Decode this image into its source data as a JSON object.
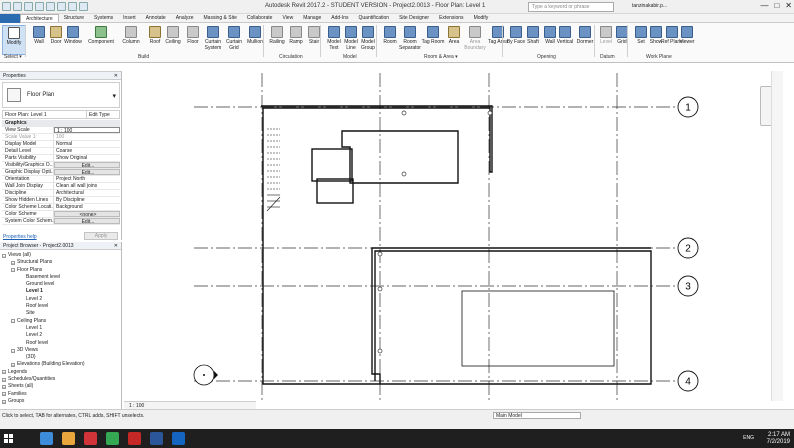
{
  "window": {
    "title": "Autodesk Revit 2017.2 - STUDENT VERSION -      Project2.0013 - Floor Plan: Level 1",
    "search_placeholder": "Type a keyword or phrase",
    "user": "tanzinakabir.p...",
    "controls": [
      "—",
      "□",
      "✕"
    ]
  },
  "ribbon_tabs": [
    "Architecture",
    "Structure",
    "Systems",
    "Insert",
    "Annotate",
    "Analyze",
    "Massing & Site",
    "Collaborate",
    "View",
    "Manage",
    "Add-Ins",
    "Quantification",
    "Site Designer",
    "Extensions",
    "Modify"
  ],
  "ribbon_buttons": [
    {
      "label": "Modify",
      "icon": "cursor-icon"
    },
    {
      "label": "Wall",
      "icon": "wall-icon"
    },
    {
      "label": "Door",
      "icon": "door-icon"
    },
    {
      "label": "Window",
      "icon": "window-icon"
    },
    {
      "label": "Component",
      "icon": "component-icon"
    },
    {
      "label": "Column",
      "icon": "column-icon"
    },
    {
      "label": "Roof",
      "icon": "roof-icon"
    },
    {
      "label": "Ceiling",
      "icon": "ceiling-icon"
    },
    {
      "label": "Floor",
      "icon": "floor-icon"
    },
    {
      "label": "Curtain System",
      "icon": "curtain-system-icon"
    },
    {
      "label": "Curtain Grid",
      "icon": "curtain-grid-icon"
    },
    {
      "label": "Mullion",
      "icon": "mullion-icon"
    },
    {
      "label": "Railing",
      "icon": "railing-icon"
    },
    {
      "label": "Ramp",
      "icon": "ramp-icon"
    },
    {
      "label": "Stair",
      "icon": "stair-icon"
    },
    {
      "label": "Model Text",
      "icon": "model-text-icon"
    },
    {
      "label": "Model Line",
      "icon": "model-line-icon"
    },
    {
      "label": "Model Group",
      "icon": "model-group-icon"
    },
    {
      "label": "Room",
      "icon": "room-icon"
    },
    {
      "label": "Room Separator",
      "icon": "room-separator-icon"
    },
    {
      "label": "Tag Room",
      "icon": "tag-room-icon"
    },
    {
      "label": "Area",
      "icon": "area-icon"
    },
    {
      "label": "Area Boundary",
      "icon": "area-boundary-icon"
    },
    {
      "label": "Tag Area",
      "icon": "tag-area-icon"
    },
    {
      "label": "By Face",
      "icon": "by-face-icon"
    },
    {
      "label": "Shaft",
      "icon": "shaft-icon"
    },
    {
      "label": "Wall",
      "icon": "wall-opening-icon"
    },
    {
      "label": "Vertical",
      "icon": "vertical-icon"
    },
    {
      "label": "Dormer",
      "icon": "dormer-icon"
    },
    {
      "label": "Level",
      "icon": "level-icon"
    },
    {
      "label": "Grid",
      "icon": "grid-icon"
    },
    {
      "label": "Set",
      "icon": "set-icon"
    },
    {
      "label": "Show",
      "icon": "show-icon"
    },
    {
      "label": "Ref Plane",
      "icon": "ref-plane-icon"
    },
    {
      "label": "Viewer",
      "icon": "viewer-icon"
    }
  ],
  "panel_labels": [
    "Select ▾",
    "Build",
    "Circulation",
    "Model",
    "Room & Area ▾",
    "Opening",
    "Datum",
    "Work Plane"
  ],
  "properties": {
    "title": "Properties",
    "type_name": "Floor Plan",
    "instance": "Floor Plan: Level 1",
    "edit_type": "Edit Type",
    "rows": [
      {
        "k": "Graphics",
        "v": "",
        "group": true
      },
      {
        "k": "View Scale",
        "v": "1 : 100",
        "box": true
      },
      {
        "k": "Scale Value    1:",
        "v": "100",
        "dim": true
      },
      {
        "k": "Display Model",
        "v": "Normal"
      },
      {
        "k": "Detail Level",
        "v": "Coarse"
      },
      {
        "k": "Parts Visibility",
        "v": "Show Original"
      },
      {
        "k": "Visibility/Graphics O...",
        "v": "Edit...",
        "btn": true
      },
      {
        "k": "Graphic Display Opti...",
        "v": "Edit...",
        "btn": true
      },
      {
        "k": "Orientation",
        "v": "Project North"
      },
      {
        "k": "Wall Join Display",
        "v": "Clean all wall joins"
      },
      {
        "k": "Discipline",
        "v": "Architectural"
      },
      {
        "k": "Show Hidden Lines",
        "v": "By Discipline"
      },
      {
        "k": "Color Scheme Locati...",
        "v": "Background"
      },
      {
        "k": "Color Scheme",
        "v": "<none>",
        "btn": true
      },
      {
        "k": "System Color Schem...",
        "v": "Edit...",
        "btn": true
      }
    ],
    "help": "Properties help",
    "apply": "Apply"
  },
  "browser": {
    "title": "Project Browser - Project2.0013",
    "items": [
      {
        "label": "Views (all)",
        "level": 0,
        "toggle": "−"
      },
      {
        "label": "Structural Plans",
        "level": 1,
        "toggle": "+"
      },
      {
        "label": "Floor Plans",
        "level": 1,
        "toggle": "−"
      },
      {
        "label": "Basement level",
        "level": 2
      },
      {
        "label": "Ground level",
        "level": 2
      },
      {
        "label": "Level 1",
        "level": 2,
        "bold": true
      },
      {
        "label": "Level 2",
        "level": 2
      },
      {
        "label": "Roof level",
        "level": 2
      },
      {
        "label": "Site",
        "level": 2
      },
      {
        "label": "Ceiling Plans",
        "level": 1,
        "toggle": "−"
      },
      {
        "label": "Level 1",
        "level": 2
      },
      {
        "label": "Level 2",
        "level": 2
      },
      {
        "label": "Roof level",
        "level": 2
      },
      {
        "label": "3D Views",
        "level": 1,
        "toggle": "−"
      },
      {
        "label": "{3D}",
        "level": 2
      },
      {
        "label": "Elevations (Building Elevation)",
        "level": 1,
        "toggle": "+"
      },
      {
        "label": "Legends",
        "level": 0,
        "toggle": "+"
      },
      {
        "label": "Schedules/Quantities",
        "level": 0,
        "toggle": "+"
      },
      {
        "label": "Sheets (all)",
        "level": 0,
        "toggle": "+"
      },
      {
        "label": "Families",
        "level": 0,
        "toggle": "+"
      },
      {
        "label": "Groups",
        "level": 0,
        "toggle": "+"
      }
    ]
  },
  "view_bar": {
    "scale": "1 : 100"
  },
  "grid_labels": [
    "1",
    "2",
    "3",
    "4"
  ],
  "status": {
    "message": "Click to select, TAB for alternates, CTRL adds, SHIFT unselects.",
    "model": "Main Model"
  },
  "taskbar": {
    "lang": "ENG",
    "time": "2:17 AM",
    "date": "7/2/2019"
  },
  "colors": {
    "accent": "#2b6cb0",
    "taskbar": "#1f1f1f"
  }
}
